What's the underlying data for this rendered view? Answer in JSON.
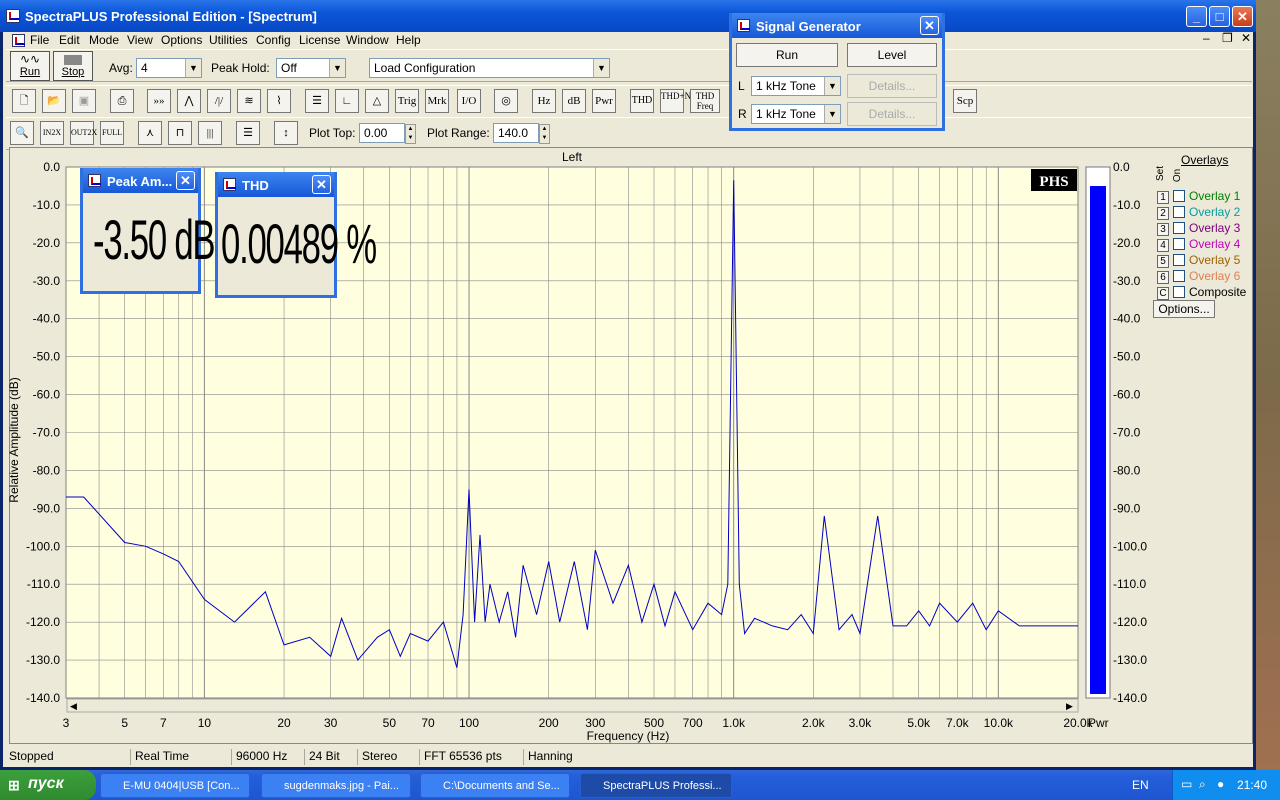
{
  "app": {
    "title": "SpectraPLUS Professional Edition - [Spectrum]"
  },
  "menu": [
    "File",
    "Edit",
    "Mode",
    "View",
    "Options",
    "Utilities",
    "Config",
    "License",
    "Window",
    "Help"
  ],
  "toolbar1": {
    "run": "Run",
    "stop": "Stop",
    "avg_label": "Avg:",
    "avg_value": "4",
    "peak_label": "Peak Hold:",
    "peak_value": "Off",
    "config_value": "Load Configuration"
  },
  "toolbar2": [
    "Trig",
    "Mrk",
    "I/O",
    "Hz",
    "dB",
    "Pwr",
    "THD",
    "THD+N",
    "THD Freq",
    "Scp"
  ],
  "toolbar3": {
    "plot_top_label": "Plot Top:",
    "plot_top_value": "0.00",
    "plot_range_label": "Plot Range:",
    "plot_range_value": "140.0"
  },
  "siggen": {
    "title": "Signal Generator",
    "run": "Run",
    "level": "Level",
    "l": "L",
    "r": "R",
    "l_value": "1 kHz Tone",
    "r_value": "1 kHz Tone",
    "details": "Details..."
  },
  "peak_window": {
    "title": "Peak Am...",
    "value": "-3.50 dB"
  },
  "thd_window": {
    "title": "THD",
    "value": "0.00489 %"
  },
  "plot": {
    "channel": "Left",
    "logo": "PHS",
    "pwr": "Pwr",
    "meter_level": 0.975
  },
  "overlays": {
    "header": "Overlays",
    "set": "Set",
    "on": "On",
    "options": "Options...",
    "items": [
      {
        "n": "1",
        "label": "Overlay 1",
        "color": "#008000"
      },
      {
        "n": "2",
        "label": "Overlay 2",
        "color": "#00a0a0"
      },
      {
        "n": "3",
        "label": "Overlay 3",
        "color": "#800080"
      },
      {
        "n": "4",
        "label": "Overlay 4",
        "color": "#c000c0"
      },
      {
        "n": "5",
        "label": "Overlay 5",
        "color": "#a06000"
      },
      {
        "n": "6",
        "label": "Overlay 6",
        "color": "#e08050"
      },
      {
        "n": "C",
        "label": "Composite",
        "color": "#000000"
      }
    ]
  },
  "status": [
    "Stopped",
    "Real Time",
    "96000 Hz",
    "24 Bit",
    "Stereo",
    "FFT 65536 pts",
    "Hanning"
  ],
  "taskbar": {
    "start": "пуск",
    "tasks": [
      "E-MU 0404|USB [Con...",
      "sugdenmaks.jpg - Pai...",
      "C:\\Documents and Se...",
      "SpectraPLUS Professi..."
    ],
    "lang": "EN",
    "time": "21:40"
  },
  "chart_data": {
    "type": "line",
    "title": "Left",
    "xlabel": "Frequency (Hz)",
    "ylabel": "Relative Amplitude (dB)",
    "xscale": "log",
    "xlim": [
      3,
      20000
    ],
    "ylim": [
      -140,
      0
    ],
    "xticks": [
      3,
      5,
      7,
      10,
      20,
      30,
      50,
      70,
      100,
      200,
      300,
      500,
      700,
      1000,
      2000,
      3000,
      5000,
      7000,
      10000,
      20000
    ],
    "xticklabels": [
      "3",
      "5",
      "7",
      "10",
      "20",
      "30",
      "50",
      "70",
      "100",
      "200",
      "300",
      "500",
      "700",
      "1.0k",
      "2.0k",
      "3.0k",
      "5.0k",
      "7.0k",
      "10.0k",
      "20.0k"
    ],
    "yticklabels": [
      "0.0",
      "-10.0",
      "-20.0",
      "-30.0",
      "-40.0",
      "-50.0",
      "-60.0",
      "-70.0",
      "-80.0",
      "-90.0",
      "-100.0",
      "-110.0",
      "-120.0",
      "-130.0",
      "-140.0"
    ],
    "series": [
      {
        "color": "#0000c0",
        "x": [
          3,
          3.5,
          5,
          6,
          7,
          8,
          10,
          13,
          17,
          20,
          25,
          30,
          33,
          38,
          45,
          50,
          55,
          60,
          70,
          80,
          90,
          95,
          100,
          105,
          110,
          115,
          120,
          130,
          140,
          150,
          160,
          180,
          200,
          220,
          250,
          280,
          300,
          350,
          400,
          450,
          500,
          550,
          600,
          700,
          800,
          900,
          950,
          1000,
          1050,
          1100,
          1200,
          1400,
          1600,
          1800,
          2000,
          2200,
          2500,
          2800,
          3000,
          3500,
          4000,
          4500,
          5000,
          5500,
          6000,
          7000,
          8000,
          9000,
          10000,
          12000,
          15000,
          20000
        ],
        "y": [
          -87,
          -87,
          -99,
          -100,
          -102,
          -104,
          -114,
          -120,
          -112,
          -126,
          -124,
          -129,
          -119,
          -130,
          -124,
          -122,
          -129,
          -123,
          -125,
          -120,
          -132,
          -118,
          -85,
          -120,
          -97,
          -120,
          -110,
          -120,
          -112,
          -124,
          -105,
          -118,
          -104,
          -120,
          -104,
          -122,
          -101,
          -115,
          -105,
          -120,
          -110,
          -121,
          -112,
          -122,
          -115,
          -118,
          -110,
          -3.5,
          -110,
          -123,
          -119,
          -121,
          -122,
          -118,
          -123,
          -92,
          -122,
          -118,
          -123,
          -92,
          -121,
          -121,
          -117,
          -121,
          -115,
          -120,
          -115,
          -122,
          -117,
          -121,
          -121,
          -121
        ]
      }
    ]
  }
}
